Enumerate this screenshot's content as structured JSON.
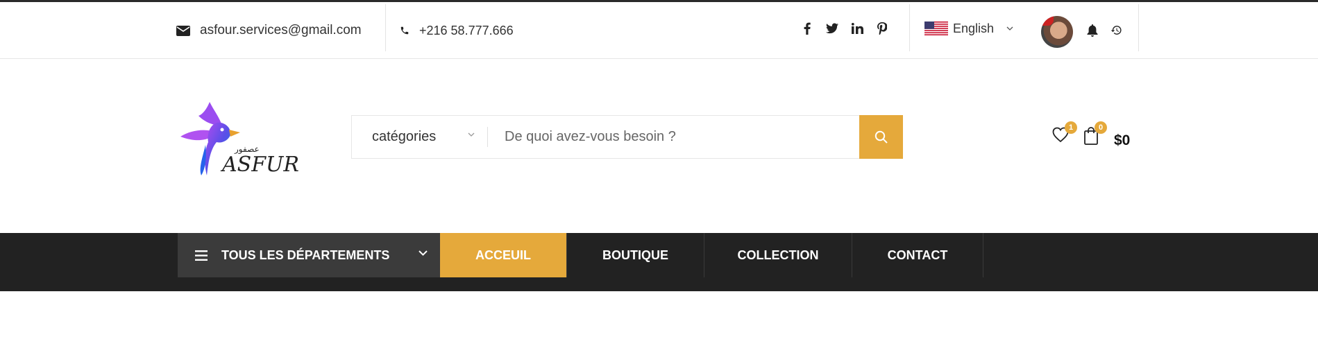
{
  "topbar": {
    "email": "asfour.services@gmail.com",
    "phone": "+216 58.777.666",
    "social_icons": [
      "facebook-icon",
      "twitter-icon",
      "linkedin-icon",
      "pinterest-icon"
    ],
    "language": "English"
  },
  "header": {
    "logo_text": "ASFUR",
    "logo_arabic": "عصفور",
    "category_select": "catégories",
    "search_placeholder": "De quoi avez-vous besoin ?",
    "wishlist_count": "1",
    "cart_count": "0",
    "cart_total": "$0"
  },
  "nav": {
    "departments": "TOUS LES DÉPARTEMENTS",
    "items": [
      {
        "label": "ACCEUIL",
        "active": true
      },
      {
        "label": "BOUTIQUE",
        "active": false
      },
      {
        "label": "COLLECTION",
        "active": false
      },
      {
        "label": "CONTACT",
        "active": false
      }
    ]
  },
  "colors": {
    "accent": "#e5a93b",
    "nav_bg": "#222222",
    "dept_bg": "#3b3b3b"
  }
}
